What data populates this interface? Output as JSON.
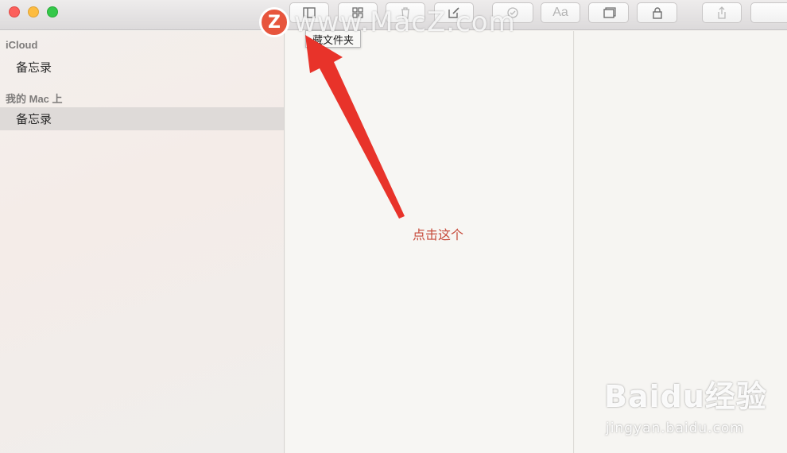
{
  "toolbar": {
    "buttons": [
      {
        "icon": "sidebar-toggle-icon"
      },
      {
        "icon": "attachments-grid-icon"
      },
      {
        "icon": "trash-icon"
      },
      {
        "icon": "compose-icon"
      },
      {
        "icon": "checklist-icon"
      },
      {
        "icon": "format-text-icon",
        "label": "Aa"
      },
      {
        "icon": "table-icon"
      },
      {
        "icon": "lock-icon"
      },
      {
        "icon": "share-icon"
      }
    ],
    "tooltip": "藏文件夹"
  },
  "sidebar": {
    "sections": [
      {
        "title": "iCloud",
        "items": [
          {
            "label": "备忘录"
          }
        ]
      },
      {
        "title": "我的 Mac 上",
        "items": [
          {
            "label": "备忘录",
            "selected": true
          }
        ]
      }
    ]
  },
  "annotation": {
    "text": "点击这个",
    "arrow_color": "#e8332a"
  },
  "watermarks": {
    "macz_logo": "Z",
    "macz_text": "www.MacZ.com",
    "baidu_main": "Baidu经验",
    "baidu_sub": "jingyan.baidu.com"
  },
  "colors": {
    "accent_red": "#e8332a",
    "selected_bg": "#dedad8"
  }
}
